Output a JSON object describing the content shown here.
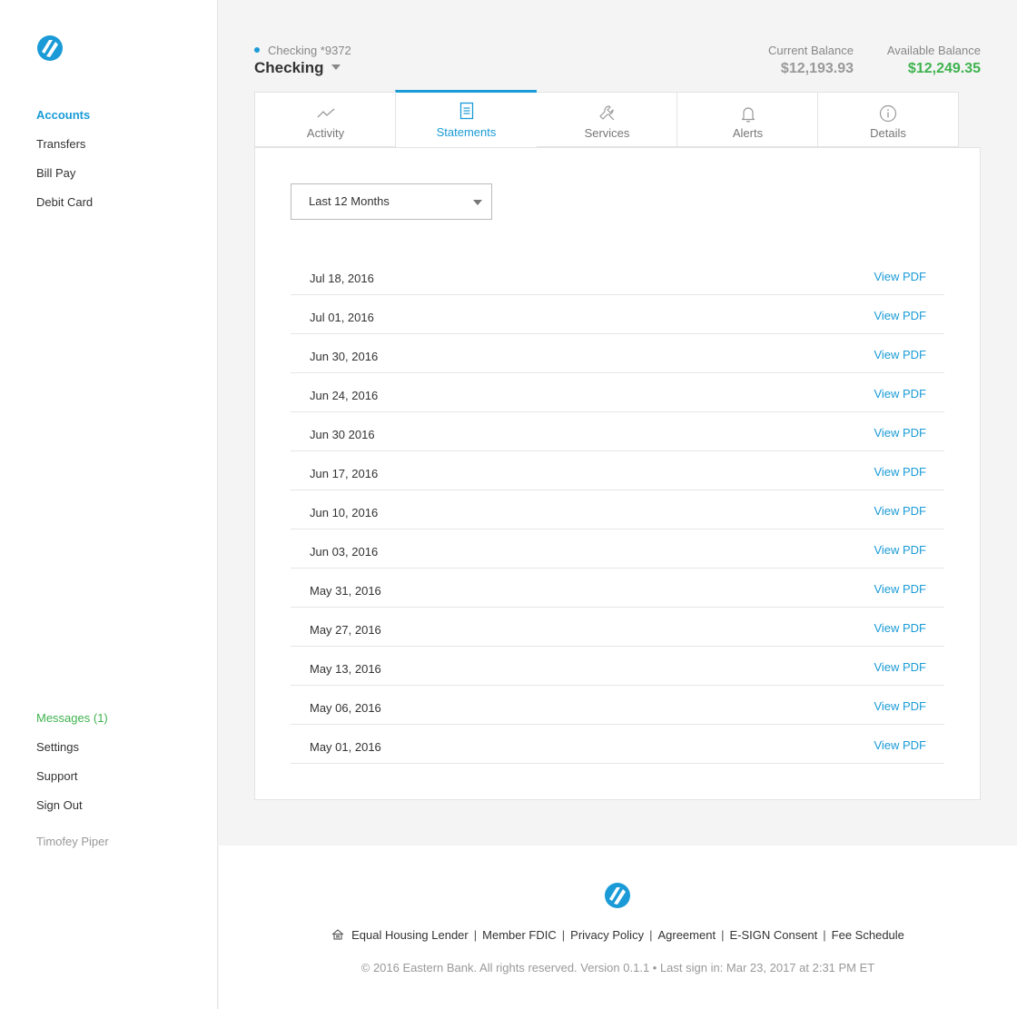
{
  "brand": {
    "color": "#1a9bd7",
    "logo_icon": "eastern-bank-logo-icon"
  },
  "sidebar": {
    "nav": [
      {
        "label": "Accounts",
        "active": true
      },
      {
        "label": "Transfers"
      },
      {
        "label": "Bill Pay"
      },
      {
        "label": "Debit Card"
      }
    ],
    "bottom": [
      {
        "label": "Messages (1)"
      },
      {
        "label": "Settings"
      },
      {
        "label": "Support"
      },
      {
        "label": "Sign Out"
      }
    ],
    "user_name": "Timofey Piper"
  },
  "header": {
    "account_sub": "Checking *9372",
    "account_title": "Checking",
    "current_balance_label": "Current Balance",
    "current_balance": "$12,193.93",
    "available_balance_label": "Available Balance",
    "available_balance": "$12,249.35"
  },
  "tabs": [
    {
      "label": "Activity",
      "icon": "activity-chart-icon"
    },
    {
      "label": "Statements",
      "icon": "document-icon",
      "active": true
    },
    {
      "label": "Services",
      "icon": "wrench-icon"
    },
    {
      "label": "Alerts",
      "icon": "bell-icon"
    },
    {
      "label": "Details",
      "icon": "info-icon"
    }
  ],
  "statements": {
    "filter": "Last 12 Months",
    "link_label": "View PDF",
    "rows": [
      {
        "date": "Jul 18, 2016"
      },
      {
        "date": "Jul 01, 2016"
      },
      {
        "date": "Jun 30, 2016"
      },
      {
        "date": "Jun 24, 2016"
      },
      {
        "date": "Jun 30 2016"
      },
      {
        "date": "Jun 17, 2016"
      },
      {
        "date": "Jun 10, 2016"
      },
      {
        "date": "Jun 03, 2016"
      },
      {
        "date": "May 31, 2016"
      },
      {
        "date": "May 27, 2016"
      },
      {
        "date": "May 13, 2016"
      },
      {
        "date": "May 06, 2016"
      },
      {
        "date": "May 01, 2016"
      }
    ]
  },
  "footer": {
    "links": [
      "Equal Housing Lender",
      "Member FDIC",
      "Privacy Policy",
      "Agreement",
      "E-SIGN Consent",
      "Fee Schedule"
    ],
    "separator": "|",
    "copyright": "© 2016 Eastern Bank. All rights reserved. Version 0.1.1 • Last sign in: Mar 23, 2017 at 2:31 PM ET"
  }
}
